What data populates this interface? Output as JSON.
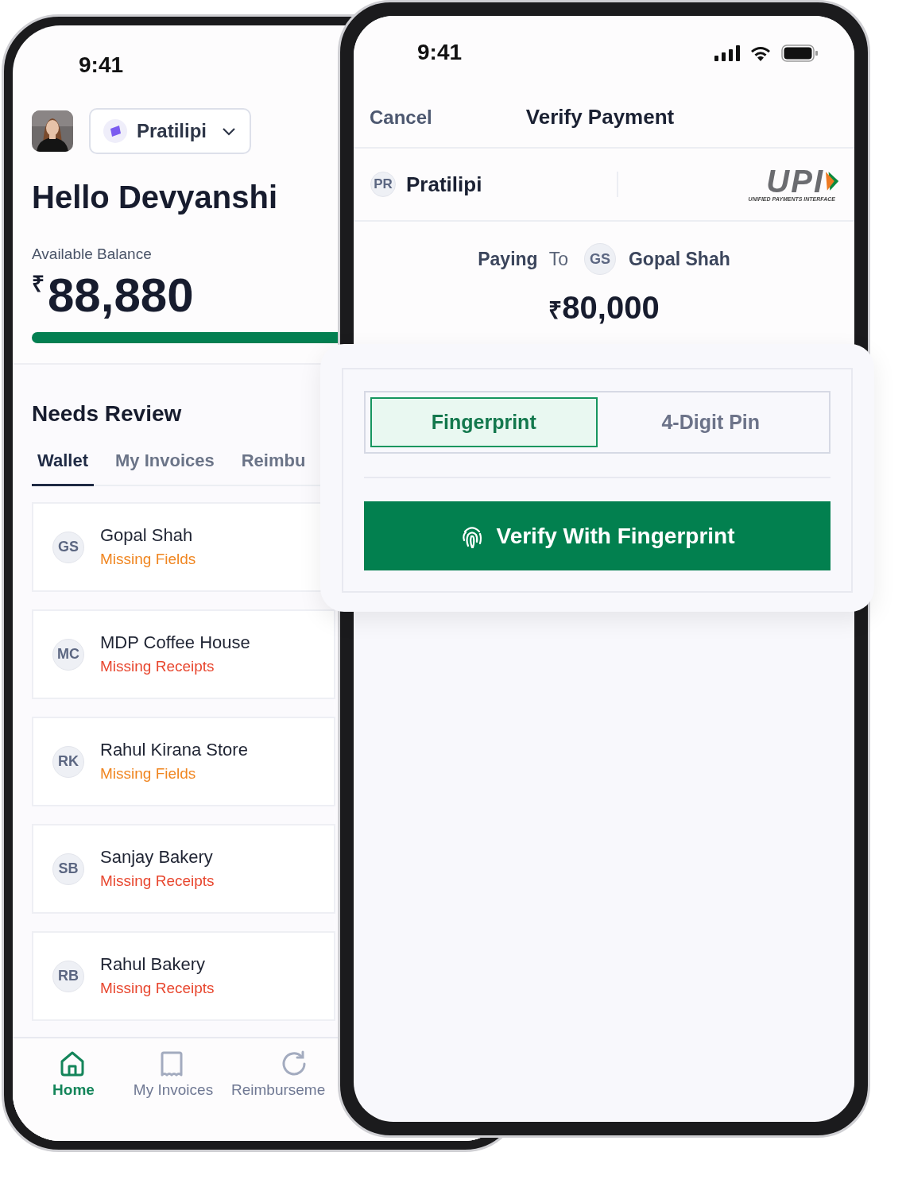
{
  "left_screen": {
    "status_time": "9:41",
    "account": {
      "name": "Pratilipi"
    },
    "greeting": "Hello Devyanshi",
    "balance_label": "Available Balance",
    "currency": "₹",
    "balance": "88,880",
    "section_title": "Needs Review",
    "tabs": [
      {
        "label": "Wallet",
        "selected": true
      },
      {
        "label": "My Invoices",
        "selected": false
      },
      {
        "label": "Reimbu",
        "selected": false
      }
    ],
    "review_items": [
      {
        "initials": "GS",
        "name": "Gopal Shah",
        "status": "Missing Fields",
        "color": "#f0851f"
      },
      {
        "initials": "MC",
        "name": "MDP Coffee House",
        "status": "Missing Receipts",
        "color": "#e8472f"
      },
      {
        "initials": "RK",
        "name": "Rahul Kirana Store",
        "status": "Missing Fields",
        "color": "#f0851f"
      },
      {
        "initials": "SB",
        "name": "Sanjay Bakery",
        "status": "Missing Receipts",
        "color": "#e8472f"
      },
      {
        "initials": "RB",
        "name": "Rahul Bakery",
        "status": "Missing Receipts",
        "color": "#e8472f"
      }
    ],
    "bottom_nav": [
      {
        "kind": "home",
        "label": "Home",
        "selected": true
      },
      {
        "kind": "invoices",
        "label": "My Invoices",
        "selected": false
      },
      {
        "kind": "reimburse",
        "label": "Reimburseme",
        "selected": false
      }
    ]
  },
  "right_screen": {
    "status_time": "9:41",
    "cancel": "Cancel",
    "title": "Verify Payment",
    "payer": {
      "initials": "PR",
      "name": "Pratilipi"
    },
    "upi_logo": {
      "text": "UPI",
      "subtitle": "UNIFIED PAYMENTS INTERFACE"
    },
    "paying_label": "Paying",
    "to_label": "To",
    "payee": {
      "initials": "GS",
      "name": "Gopal Shah"
    },
    "currency": "₹",
    "amount": "80,000"
  },
  "verify_sheet": {
    "methods": [
      {
        "label": "Fingerprint",
        "selected": true
      },
      {
        "label": "4-Digit Pin",
        "selected": false
      }
    ],
    "button": "Verify With Fingerprint"
  }
}
